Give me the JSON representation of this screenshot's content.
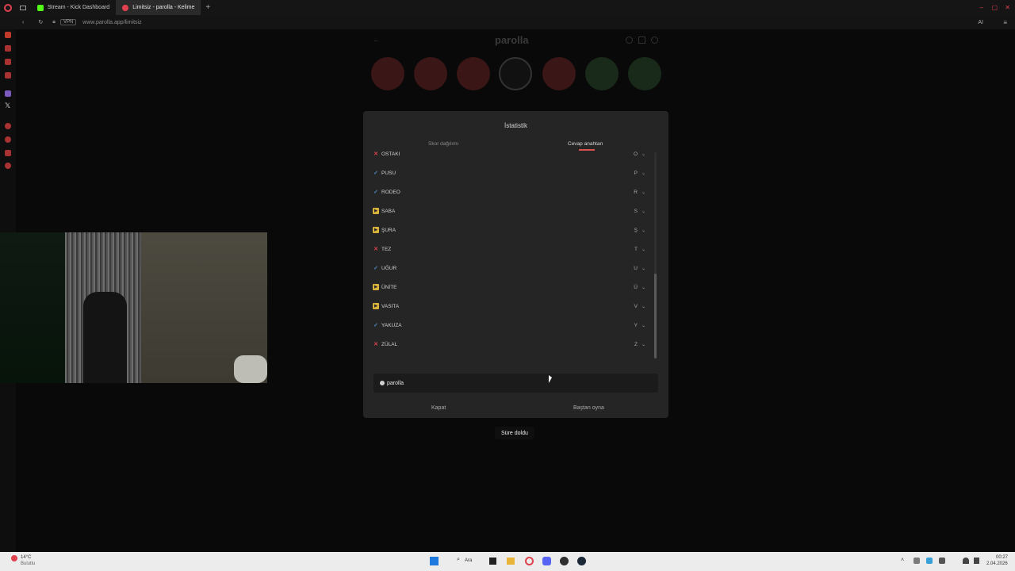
{
  "browser": {
    "tabs": [
      {
        "label": "Stream - Kick Dashboard"
      },
      {
        "label": "Limitsiz - parolla - Kelime"
      }
    ],
    "vpn_label": "VPN",
    "url": "www.parolla.app/limitsiz"
  },
  "game": {
    "title": "parolla"
  },
  "modal": {
    "title": "İstatistik",
    "tabs": [
      "Skor dağılımı",
      "Cevap anahtarı"
    ],
    "rows": [
      {
        "status": "x",
        "word": "OSTAKI",
        "letter": "O"
      },
      {
        "status": "ok",
        "word": "PUSU",
        "letter": "P"
      },
      {
        "status": "ok",
        "word": "RODEO",
        "letter": "R"
      },
      {
        "status": "half",
        "word": "SABA",
        "letter": "S"
      },
      {
        "status": "half",
        "word": "ŞURA",
        "letter": "Ş"
      },
      {
        "status": "x",
        "word": "TEZ",
        "letter": "T"
      },
      {
        "status": "ok",
        "word": "UĞUR",
        "letter": "U"
      },
      {
        "status": "half",
        "word": "ÜNİTE",
        "letter": "Ü"
      },
      {
        "status": "half",
        "word": "VASITA",
        "letter": "V"
      },
      {
        "status": "ok",
        "word": "YAKUZA",
        "letter": "Y"
      },
      {
        "status": "x",
        "word": "ZÜLAL",
        "letter": "Z"
      }
    ],
    "share_label": "parolla",
    "close_label": "Kapat",
    "restart_label": "Baştan oyna"
  },
  "toast": "Süre doldu",
  "taskbar": {
    "weather": "14°C",
    "weather_sub": "Bulutlu",
    "search": "Ara",
    "time": "00:27",
    "date": "2.04.2026"
  },
  "colors": {
    "accent_red": "#e0414e",
    "check_blue": "#4a8ac9",
    "pass_yellow": "#d8b23a"
  }
}
